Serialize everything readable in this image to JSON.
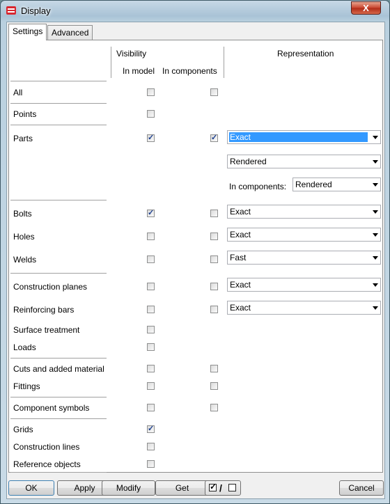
{
  "window": {
    "title": "Display",
    "close_label": "X"
  },
  "tabs": [
    {
      "label": "Settings"
    },
    {
      "label": "Advanced"
    }
  ],
  "headers": {
    "visibility": "Visibility",
    "in_model": "In model",
    "in_components": "In components",
    "representation": "Representation"
  },
  "rows": {
    "all": {
      "label": "All",
      "in_model": false,
      "in_components": false
    },
    "points": {
      "label": "Points",
      "in_model": false
    },
    "parts": {
      "label": "Parts",
      "in_model": true,
      "in_components": true,
      "rep": "Exact",
      "rep2": "Rendered",
      "in_comp_label": "In components:",
      "rep3": "Rendered"
    },
    "bolts": {
      "label": "Bolts",
      "in_model": true,
      "in_components": false,
      "rep": "Exact"
    },
    "holes": {
      "label": "Holes",
      "in_model": false,
      "in_components": false,
      "rep": "Exact"
    },
    "welds": {
      "label": "Welds",
      "in_model": false,
      "in_components": false,
      "rep": "Fast"
    },
    "construction_planes": {
      "label": "Construction planes",
      "in_model": false,
      "in_components": false,
      "rep": "Exact"
    },
    "reinforcing_bars": {
      "label": "Reinforcing bars",
      "in_model": false,
      "in_components": false,
      "rep": "Exact"
    },
    "surface_treatment": {
      "label": "Surface treatment",
      "in_model": false
    },
    "loads": {
      "label": "Loads",
      "in_model": false
    },
    "cuts": {
      "label": "Cuts and added material",
      "in_model": false,
      "in_components": false
    },
    "fittings": {
      "label": "Fittings",
      "in_model": false,
      "in_components": false
    },
    "component_symbols": {
      "label": "Component symbols",
      "in_model": false,
      "in_components": false
    },
    "grids": {
      "label": "Grids",
      "in_model": true
    },
    "construction_lines": {
      "label": "Construction lines",
      "in_model": false
    },
    "reference_objects": {
      "label": "Reference objects",
      "in_model": false
    }
  },
  "buttons": {
    "ok": "OK",
    "apply": "Apply",
    "modify": "Modify",
    "get": "Get",
    "cancel": "Cancel"
  },
  "colors": {
    "selection": "#3399ff",
    "close": "#c8432d",
    "frame": "#b9d0df"
  },
  "icons": [
    "display-app-icon",
    "close-icon",
    "dropdown-arrow-icon",
    "check-all-toggle-icon"
  ]
}
